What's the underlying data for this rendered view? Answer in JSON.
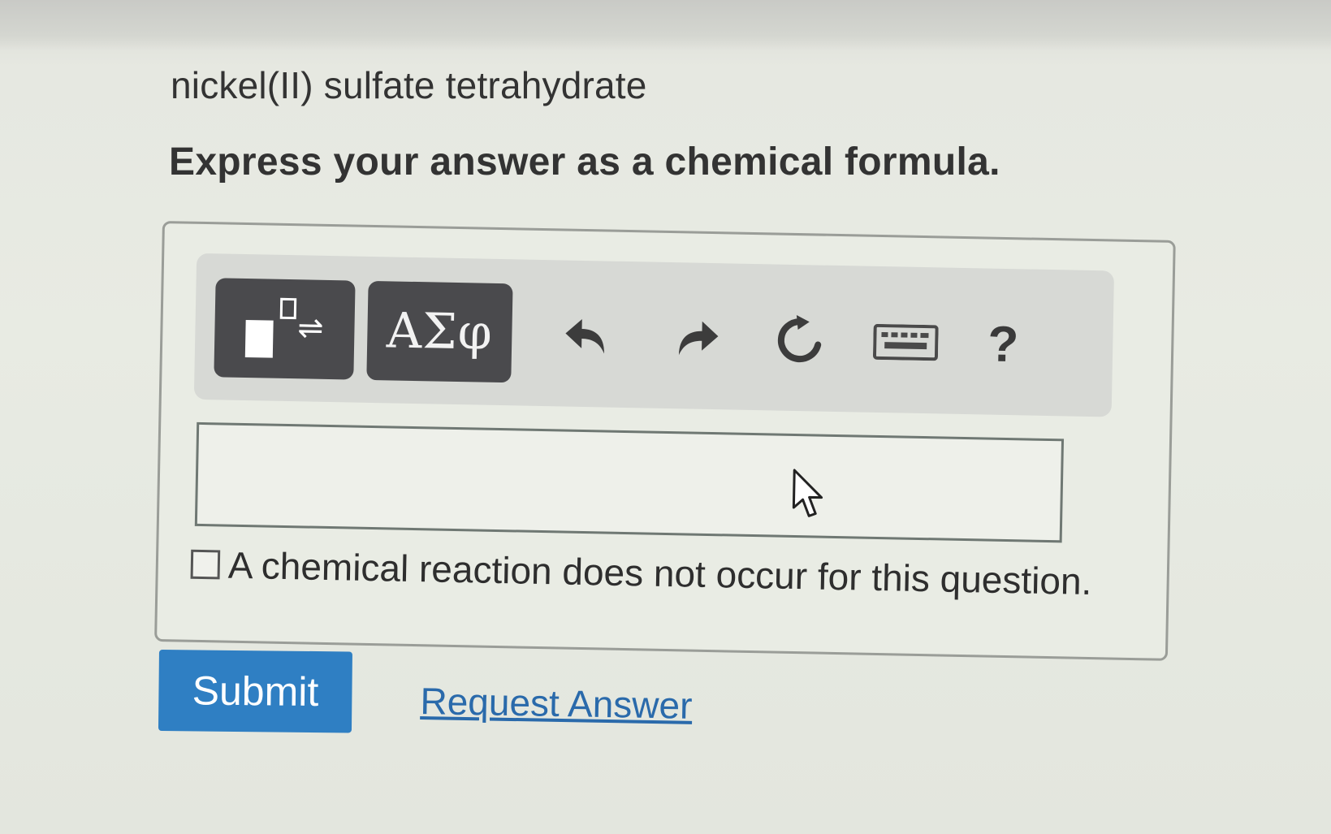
{
  "question": {
    "title": "nickel(II) sulfate tetrahydrate",
    "instruction": "Express your answer as a chemical formula."
  },
  "toolbar": {
    "templates_icon": "superscript-templates-equilibrium-icon",
    "greek_label": "ΑΣφ",
    "undo_icon": "undo-icon",
    "redo_icon": "redo-icon",
    "reset_icon": "reset-icon",
    "keyboard_icon": "keyboard-icon",
    "help_label": "?"
  },
  "answer": {
    "value": "",
    "checkbox_label": "A chemical reaction does not occur for this question.",
    "checkbox_checked": false
  },
  "actions": {
    "submit_label": "Submit",
    "request_answer_label": "Request Answer"
  },
  "colors": {
    "submit_bg": "#2f7fc3",
    "link": "#2a6aab",
    "dark_button": "#4a4a4d"
  }
}
